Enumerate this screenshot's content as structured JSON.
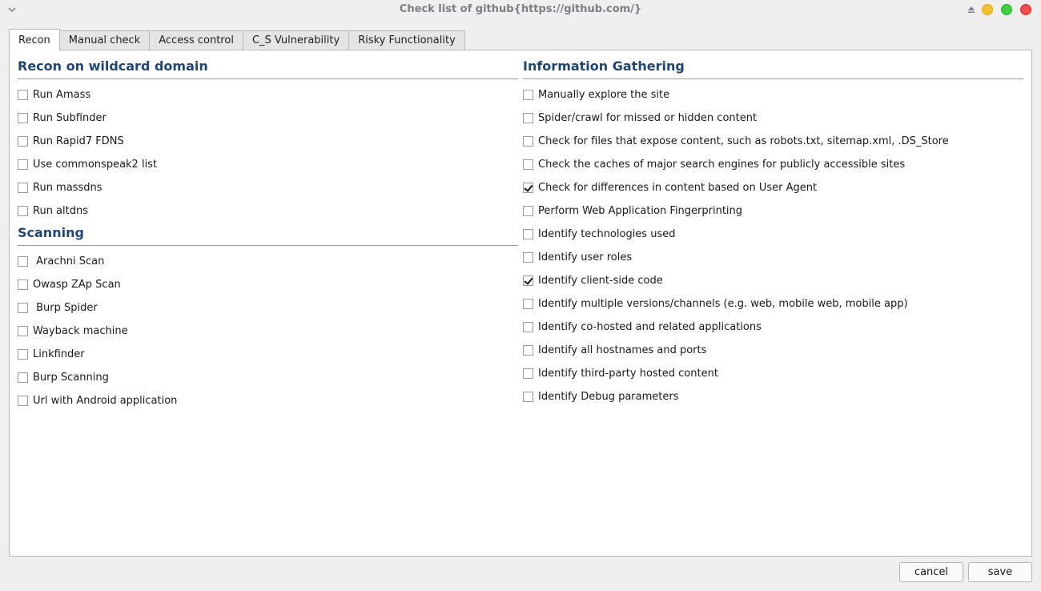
{
  "window": {
    "title": "Check list of github{https://github.com/}",
    "icons": [
      "chevron-down-icon",
      "eject-icon",
      "minimize-icon",
      "maximize-icon",
      "close-icon"
    ]
  },
  "tabs": [
    {
      "label": "Recon",
      "active": true
    },
    {
      "label": "Manual check",
      "active": false
    },
    {
      "label": "Access control",
      "active": false
    },
    {
      "label": "C_S Vulnerability",
      "active": false
    },
    {
      "label": "Risky Functionality",
      "active": false
    }
  ],
  "left": {
    "recon": {
      "title": "Recon on wildcard domain",
      "items": [
        {
          "label": "Run Amass",
          "checked": false
        },
        {
          "label": "Run Subfinder",
          "checked": false
        },
        {
          "label": "Run Rapid7 FDNS",
          "checked": false
        },
        {
          "label": "Use commonspeak2 list",
          "checked": false
        },
        {
          "label": "Run massdns",
          "checked": false
        },
        {
          "label": "Run altdns",
          "checked": false
        }
      ]
    },
    "scanning": {
      "title": "Scanning",
      "items": [
        {
          "label": " Arachni Scan",
          "checked": false
        },
        {
          "label": "Owasp ZAp Scan",
          "checked": false
        },
        {
          "label": " Burp Spider",
          "checked": false
        },
        {
          "label": "Wayback machine",
          "checked": false
        },
        {
          "label": "Linkfinder",
          "checked": false
        },
        {
          "label": "Burp Scanning",
          "checked": false
        },
        {
          "label": "Url with Android application",
          "checked": false
        }
      ]
    }
  },
  "right": {
    "info": {
      "title": "Information Gathering",
      "items": [
        {
          "label": "Manually explore the site",
          "checked": false
        },
        {
          "label": "Spider/crawl for missed or hidden content",
          "checked": false
        },
        {
          "label": "Check for files that expose content, such as robots.txt, sitemap.xml, .DS_Store",
          "checked": false
        },
        {
          "label": "Check the caches of major search engines for publicly accessible sites",
          "checked": false
        },
        {
          "label": "Check for differences in content based on User Agent",
          "checked": true
        },
        {
          "label": "Perform Web Application Fingerprinting",
          "checked": false
        },
        {
          "label": "Identify technologies used",
          "checked": false
        },
        {
          "label": "Identify user roles",
          "checked": false
        },
        {
          "label": "Identify client-side code",
          "checked": true
        },
        {
          "label": "Identify multiple versions/channels (e.g. web, mobile web, mobile app)",
          "checked": false
        },
        {
          "label": "Identify co-hosted and related applications",
          "checked": false
        },
        {
          "label": "Identify all hostnames and ports",
          "checked": false
        },
        {
          "label": "Identify third-party hosted content",
          "checked": false
        },
        {
          "label": "Identify Debug parameters",
          "checked": false
        }
      ]
    }
  },
  "buttons": {
    "cancel": "cancel",
    "save": "save"
  }
}
